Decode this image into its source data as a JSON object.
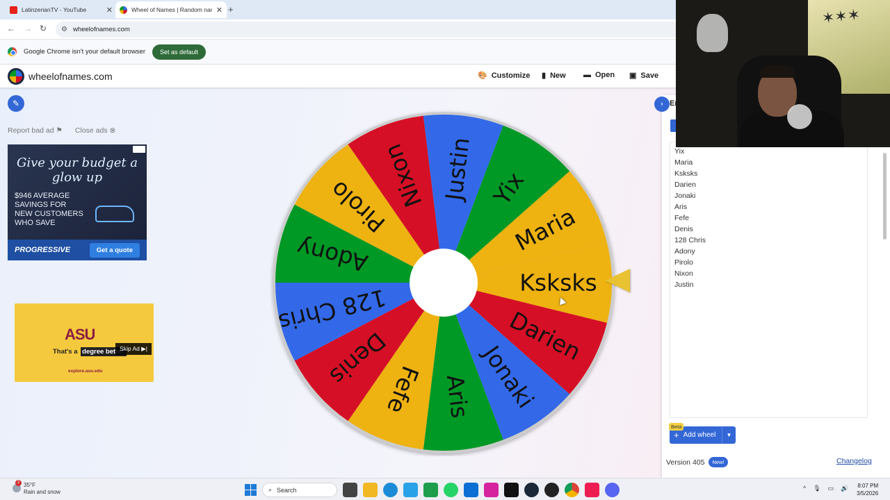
{
  "browser": {
    "tabs": [
      {
        "title": "LatinzerianTV - YouTube",
        "active": false
      },
      {
        "title": "Wheel of Names | Random nam",
        "active": true
      }
    ],
    "new_tab": "+",
    "url": "wheelofnames.com",
    "infobar_text": "Google Chrome isn't your default browser",
    "set_default": "Set as default"
  },
  "site": {
    "name": "wheelofnames.com",
    "menu": {
      "customize": "Customize",
      "new": "New",
      "open": "Open",
      "save": "Save"
    }
  },
  "ads": {
    "report": "Report bad ad",
    "close": "Close ads",
    "ad1": {
      "headline": "Give your budget a glow up",
      "body": "$946 AVERAGE SAVINGS FOR NEW CUSTOMERS WHO SAVE",
      "brand": "PROGRESSIVE",
      "cta": "Get a quote"
    },
    "ad2": {
      "logo": "ASU",
      "tag_prefix": "That's a",
      "tag_highlight": "degree better.",
      "url": "explore.asu.edu",
      "skip": "Skip Ad ▶|"
    }
  },
  "wheel": {
    "colors": [
      "#eeb211",
      "#d50f25",
      "#3369e8",
      "#009925"
    ],
    "slices": [
      "Ksksks",
      "Darien",
      "Jonaki",
      "Aris",
      "Fefe",
      "Denis",
      "128 Chris",
      "Adony",
      "Pirolo",
      "Nixon",
      "Justin",
      "Yix",
      "Maria"
    ]
  },
  "panel": {
    "tab_label": "En",
    "entries": [
      "Yix",
      "Maria",
      "Ksksks",
      "Darien",
      "Jonaki",
      "Aris",
      "Fefe",
      "Denis",
      "128 Chris",
      "Adony",
      "Pirolo",
      "Nixon",
      "Justin"
    ],
    "beta": "Beta",
    "add_wheel": "Add wheel",
    "version": "Version 405",
    "new_badge": "New!",
    "changelog": "Changelog"
  },
  "taskbar": {
    "temp": "35°F",
    "weather": "Rain and snow",
    "weather_badge": "2",
    "search": "Search",
    "time": "8:07 PM",
    "date": "3/5/2026"
  }
}
